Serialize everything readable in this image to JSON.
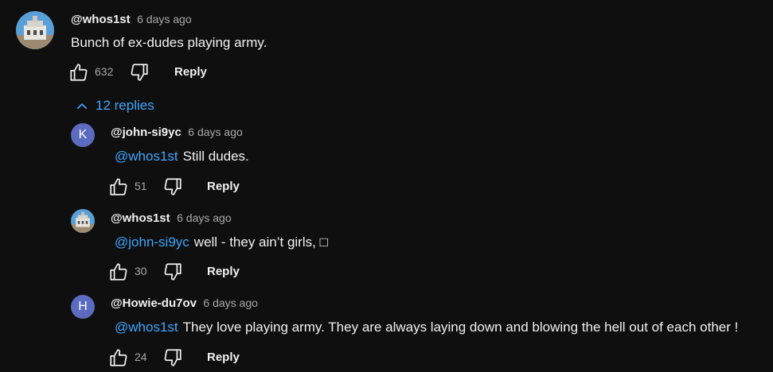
{
  "main_comment": {
    "author": "@whos1st",
    "time": "6 days ago",
    "text": "Bunch of ex-dudes playing army.",
    "likes": "632",
    "reply_label": "Reply"
  },
  "replies_toggle": {
    "label": "12 replies"
  },
  "replies": [
    {
      "author": "@john-si9yc",
      "time": "6 days ago",
      "avatar_letter": "K",
      "mention": "@whos1st",
      "text": "Still dudes.",
      "likes": "51",
      "reply_label": "Reply"
    },
    {
      "author": "@whos1st",
      "time": "6 days ago",
      "mention": "@john-si9yc",
      "text": "well - they ain’t girls, □",
      "likes": "30",
      "reply_label": "Reply"
    },
    {
      "author": "@Howie-du7ov",
      "time": "6 days ago",
      "avatar_letter": "H",
      "mention": "@whos1st",
      "text": "They love playing army. They are always laying down and blowing the hell out of each other !",
      "likes": "24",
      "reply_label": "Reply"
    }
  ],
  "colors": {
    "background": "#0f0f0f",
    "link": "#3ea6ff",
    "avatar_letter_bg": "#5c6bc0"
  },
  "icons": {
    "like": "thumbs-up-icon",
    "dislike": "thumbs-down-icon",
    "collapse": "chevron-up-icon"
  }
}
